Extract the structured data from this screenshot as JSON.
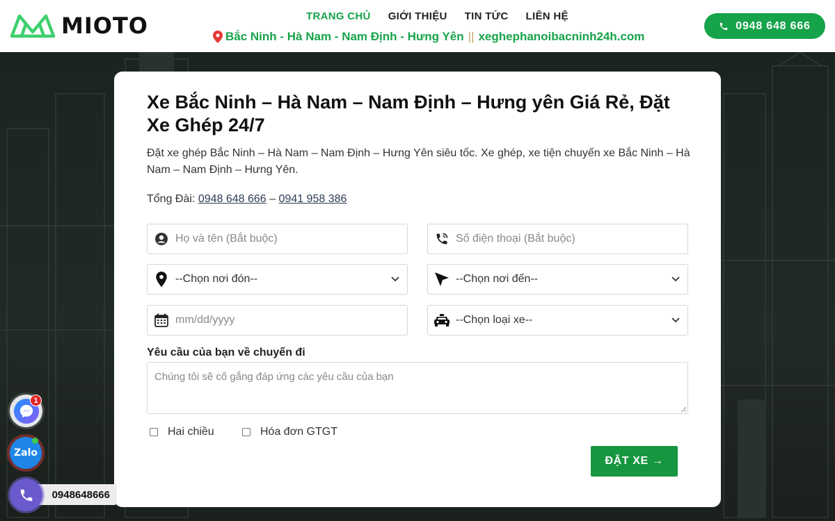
{
  "brand": {
    "name": "MIOTO",
    "accent": "#16a34a"
  },
  "nav": {
    "items": [
      {
        "label": "TRANG CHỦ",
        "active": true
      },
      {
        "label": "GIỚI THIỆU",
        "active": false
      },
      {
        "label": "TIN TỨC",
        "active": false
      },
      {
        "label": "LIÊN HỆ",
        "active": false
      }
    ]
  },
  "tagline": {
    "route": "Bắc Ninh - Hà Nam - Nam Định - Hưng Yên",
    "separator": "||",
    "site": "xeghephanoibacninh24h.com"
  },
  "header_call": {
    "label": "0948 648 666",
    "icon": "phone-icon"
  },
  "card": {
    "title": "Xe Bắc Ninh – Hà Nam – Nam Định – Hưng yên Giá Rẻ, Đặt Xe Ghép 24/7",
    "description": "Đặt xe ghép Bắc Ninh – Hà Nam – Nam Định – Hưng Yên siêu tốc. Xe ghép, xe tiện chuyến xe Bắc Ninh – Hà Nam – Nam Định – Hưng Yên.",
    "hotline_label": "Tổng Đài:",
    "hotline_1": "0948 648 666",
    "hotline_sep": "–",
    "hotline_2": "0941 958 386"
  },
  "form": {
    "name_placeholder": "Họ và tên (Bắt buộc)",
    "phone_placeholder": "Số điện thoại (Bắt buộc)",
    "pickup_selected": "--Chọn nơi đón--",
    "dropoff_selected": "--Chọn nơi đến--",
    "date_placeholder": "mm/dd/yyyy",
    "vehicle_selected": "--Chọn loại xe--",
    "request_label": "Yêu cầu của bạn về chuyến đi",
    "request_placeholder": "Chúng tôi sẽ cố gắng đáp ứng các yêu cầu của bạn",
    "checkbox_round_trip": "Hai chiều",
    "checkbox_invoice": "Hóa đơn GTGT",
    "submit_label": "ĐẶT XE →"
  },
  "floating": {
    "messenger_badge": "1",
    "zalo_label": "Zalo",
    "phone_label": "0948648666"
  }
}
